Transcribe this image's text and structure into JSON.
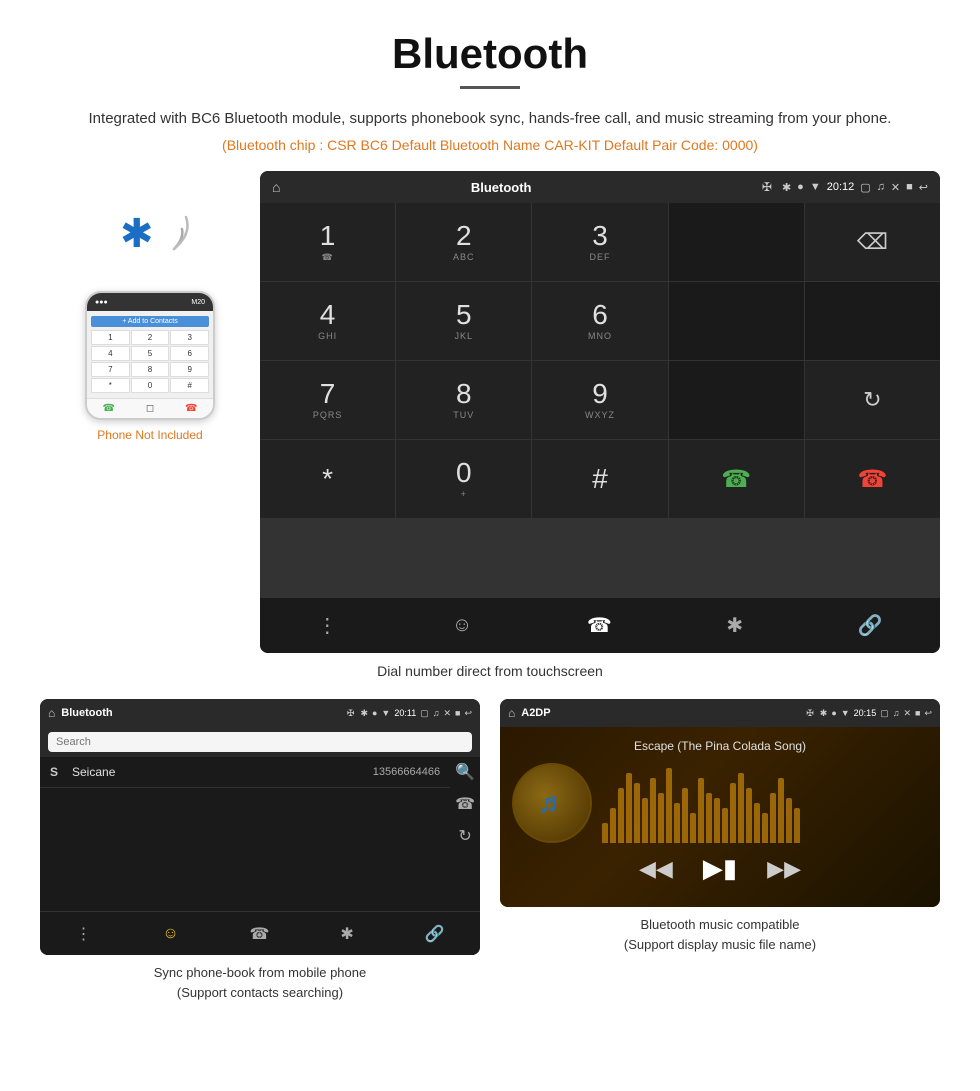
{
  "page": {
    "title": "Bluetooth",
    "description": "Integrated with BC6 Bluetooth module, supports phonebook sync, hands-free call, and music streaming from your phone.",
    "specs": "(Bluetooth chip : CSR BC6    Default Bluetooth Name CAR-KIT    Default Pair Code: 0000)",
    "caption_main": "Dial number direct from touchscreen",
    "caption_phonebook": "Sync phone-book from mobile phone\n(Support contacts searching)",
    "caption_music": "Bluetooth music compatible\n(Support display music file name)"
  },
  "dial_screen": {
    "status_title": "Bluetooth",
    "status_time": "20:12",
    "keys": [
      {
        "digit": "1",
        "sub": "☎"
      },
      {
        "digit": "2",
        "sub": "ABC"
      },
      {
        "digit": "3",
        "sub": "DEF"
      },
      {
        "digit": "",
        "sub": ""
      },
      {
        "digit": "⌫",
        "sub": ""
      },
      {
        "digit": "4",
        "sub": "GHI"
      },
      {
        "digit": "5",
        "sub": "JKL"
      },
      {
        "digit": "6",
        "sub": "MNO"
      },
      {
        "digit": "",
        "sub": ""
      },
      {
        "digit": "",
        "sub": ""
      },
      {
        "digit": "7",
        "sub": "PQRS"
      },
      {
        "digit": "8",
        "sub": "TUV"
      },
      {
        "digit": "9",
        "sub": "WXYZ"
      },
      {
        "digit": "",
        "sub": ""
      },
      {
        "digit": "↺",
        "sub": ""
      },
      {
        "digit": "*",
        "sub": ""
      },
      {
        "digit": "0",
        "sub": "+"
      },
      {
        "digit": "#",
        "sub": ""
      },
      {
        "digit": "📞",
        "sub": ""
      },
      {
        "digit": "📵",
        "sub": ""
      }
    ],
    "nav_icons": [
      "⊞",
      "👤",
      "📞",
      "✱",
      "🔗"
    ]
  },
  "phonebook_screen": {
    "status_title": "Bluetooth",
    "status_time": "20:11",
    "search_placeholder": "Search",
    "contact": {
      "letter": "S",
      "name": "Seicane",
      "number": "13566664466"
    },
    "right_icons": [
      "🔍",
      "📞",
      "↺"
    ],
    "nav_icons": [
      "⊞",
      "👤",
      "📞",
      "✱",
      "🔗"
    ]
  },
  "music_screen": {
    "status_title": "A2DP",
    "status_time": "20:15",
    "song_title": "Escape (The Pina Colada Song)",
    "viz_heights": [
      20,
      35,
      55,
      70,
      60,
      45,
      65,
      50,
      75,
      40,
      55,
      30,
      65,
      50,
      45,
      35,
      60,
      70,
      55,
      40,
      30,
      50,
      65,
      45,
      35
    ],
    "controls": [
      "⏮",
      "⏭⏸",
      "⏭"
    ]
  },
  "phone_mockup": {
    "keys": [
      "1",
      "2",
      "3",
      "4",
      "5",
      "6",
      "7",
      "8",
      "9",
      "*",
      "0",
      "#"
    ],
    "not_included": "Phone Not Included"
  }
}
